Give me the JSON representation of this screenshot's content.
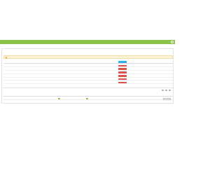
{
  "header": {
    "app_title": "",
    "menu": [
      "",
      ""
    ],
    "accent_color": "#8bc34a"
  },
  "panel1": {
    "title": "",
    "warning_text": "",
    "columns": [
      "",
      "",
      "",
      ""
    ],
    "subcolumn": "",
    "rows": [
      {
        "c1": "",
        "c2": "",
        "c3": "",
        "c4": ""
      },
      {
        "c1": "",
        "c2": "",
        "c3": "",
        "c4": ""
      },
      {
        "c1": "",
        "c2": "",
        "c3": "",
        "c4": ""
      },
      {
        "c1": "",
        "c2": "",
        "c3": "",
        "c4": ""
      },
      {
        "c1": "",
        "c2": "",
        "c3": "",
        "c4": ""
      },
      {
        "c1": "",
        "c2": "",
        "c3": "",
        "c4": ""
      }
    ],
    "action_label": "",
    "primary_label": ""
  },
  "panel2": {
    "title": "",
    "columns": [
      "",
      "",
      ""
    ],
    "row": {
      "c1": "",
      "action": ""
    }
  }
}
